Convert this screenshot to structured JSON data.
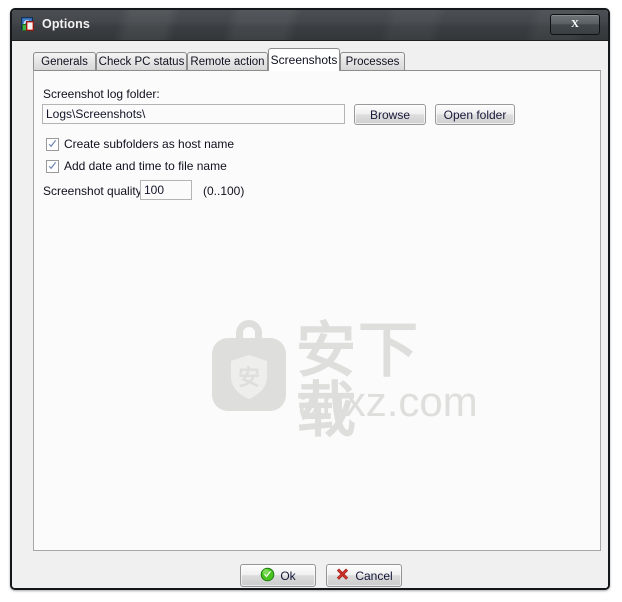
{
  "window": {
    "title": "Options",
    "icon": "options-image-icon",
    "close_label": "X"
  },
  "tabs": [
    {
      "label": "Generals",
      "selected": false
    },
    {
      "label": "Check PC status",
      "selected": false
    },
    {
      "label": "Remote action",
      "selected": false
    },
    {
      "label": "Screenshots",
      "selected": true
    },
    {
      "label": "Processes",
      "selected": false
    }
  ],
  "screenshots_tab": {
    "folder_label": "Screenshot log folder:",
    "folder_value": "Logs\\Screenshots\\",
    "browse_label": "Browse",
    "open_folder_label": "Open folder",
    "checkboxes": [
      {
        "label": "Create subfolders as host name",
        "checked": true
      },
      {
        "label": "Add date and time to file name",
        "checked": true
      }
    ],
    "quality_label": "Screenshot quality",
    "quality_value": "100",
    "quality_hint": "(0..100)"
  },
  "watermark": {
    "chinese": "安下载",
    "url": "anxz.com",
    "logo_glyph": "安"
  },
  "footer": {
    "ok_label": "Ok",
    "cancel_label": "Cancel",
    "ok_icon": "green-check-icon",
    "cancel_icon": "red-x-icon"
  },
  "colors": {
    "titlebar": "#3b3f43",
    "panel_bg": "#fbfbfb",
    "dialog_bg": "#f0f0f0",
    "accent_check": "#6a82ad",
    "ok_green": "#3fa61c",
    "cancel_red": "#d0342c",
    "watermark_gray": "#dededc"
  }
}
